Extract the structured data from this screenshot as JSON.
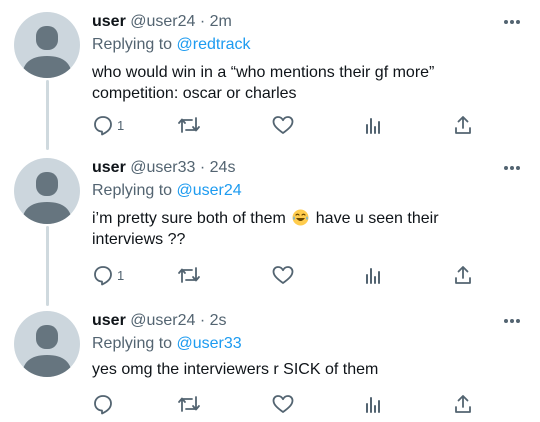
{
  "tweets": [
    {
      "name": "user",
      "handle": "@user24",
      "separator": "·",
      "time": "2m",
      "replying_prefix": "Replying to",
      "replying_to": "@redtrack",
      "text_line1": "who would win in a “who mentions their gf more”",
      "text_line2": "competition: oscar or charles",
      "reply_count": "1"
    },
    {
      "name": "user",
      "handle": "@user33",
      "separator": "·",
      "time": "24s",
      "replying_prefix": "Replying to",
      "replying_to": "@user24",
      "text_line1_a": "i’m pretty sure both of them",
      "emoji": "crying-laughing-face-icon",
      "text_line1_b": "have u seen their",
      "text_line2": "interviews ??",
      "reply_count": "1"
    },
    {
      "name": "user",
      "handle": "@user24",
      "separator": "·",
      "time": "2s",
      "replying_prefix": "Replying to",
      "replying_to": "@user33",
      "text_line1": "yes omg the interviewers r SICK of them",
      "reply_count": ""
    }
  ],
  "colors": {
    "accent": "#1d9bf0",
    "secondary_text": "#536471",
    "avatar_bg": "#ccd6dd",
    "avatar_figure": "#66757f",
    "thread_line": "#cfd9de"
  }
}
